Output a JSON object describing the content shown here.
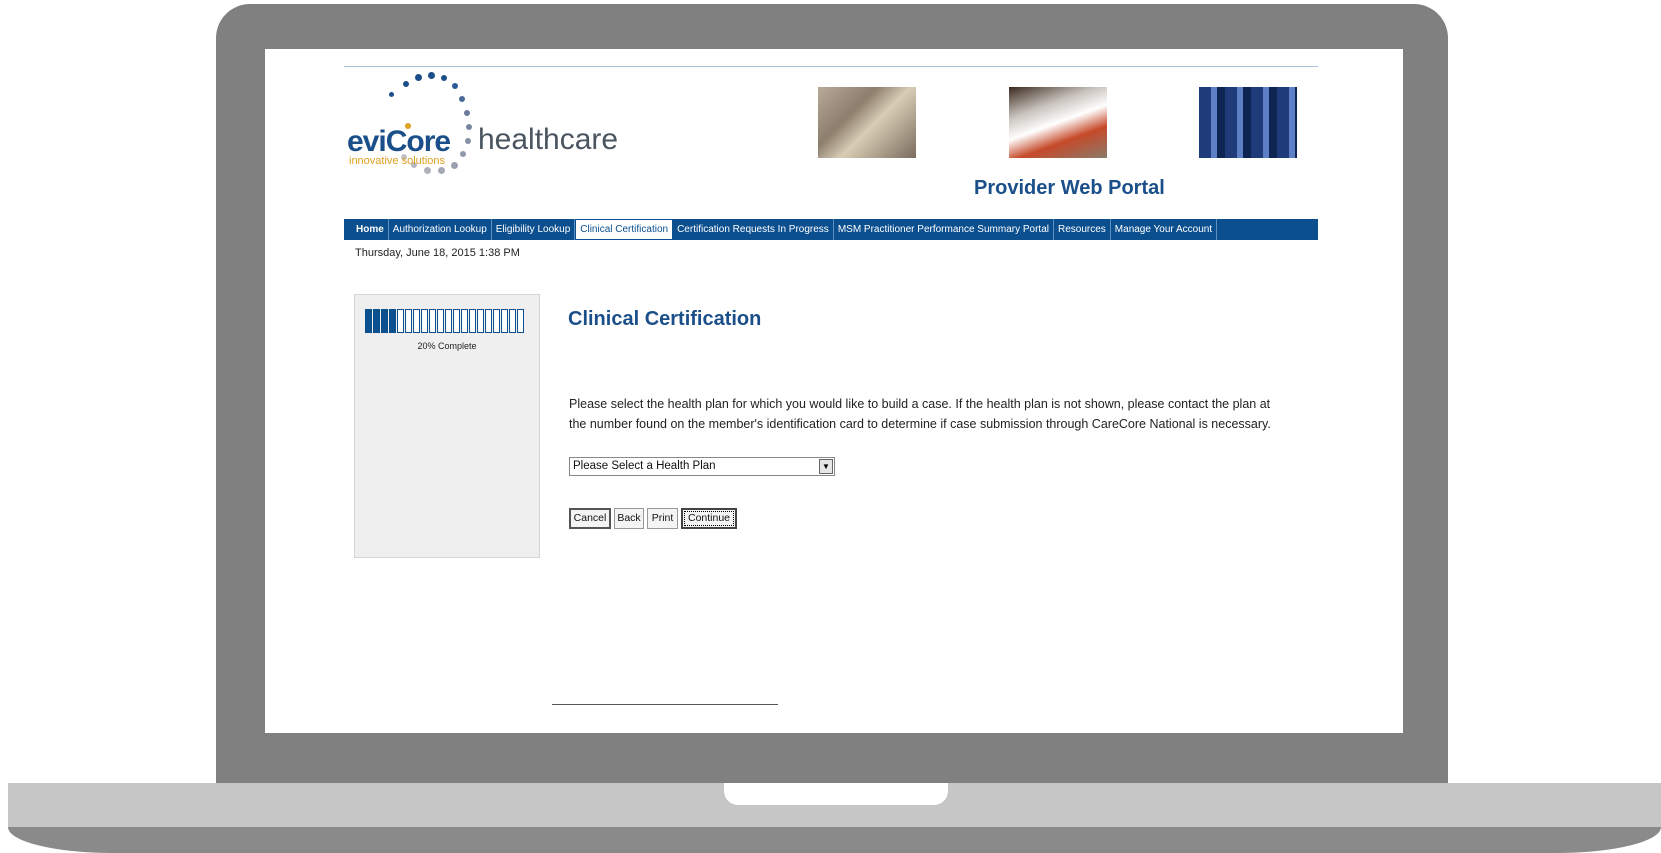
{
  "logo": {
    "brand_evi": "evi",
    "brand_core": "Core",
    "tagline": "innovative solutions",
    "suffix": "healthcare"
  },
  "header": {
    "portal_title": "Provider Web Portal"
  },
  "nav": {
    "items": [
      {
        "label": "Home"
      },
      {
        "label": "Authorization Lookup"
      },
      {
        "label": "Eligibility Lookup"
      },
      {
        "label": "Clinical Certification"
      },
      {
        "label": "Certification Requests In Progress"
      },
      {
        "label": "MSM Practitioner Performance Summary Portal"
      },
      {
        "label": "Resources"
      },
      {
        "label": "Manage Your Account"
      }
    ],
    "active": "Clinical Certification"
  },
  "datetime": "Thursday, June 18, 2015 1:38 PM",
  "progress": {
    "label": "20% Complete",
    "fraction": 0.2,
    "segments_total": 20,
    "segments_filled": 4
  },
  "main": {
    "title": "Clinical Certification",
    "instructions": "Please select the health plan for which you would like to build a case. If the health plan is not shown, please contact the plan at the number found on the member's identification card to determine if case submission through CareCore National is necessary.",
    "select_value": "Please Select a Health Plan"
  },
  "buttons": {
    "cancel": "Cancel",
    "back": "Back",
    "print": "Print",
    "continue": "Continue"
  },
  "colors": {
    "brand_blue": "#0b4f8f",
    "title_blue": "#1b4f8a",
    "accent_orange": "#e0a020"
  }
}
